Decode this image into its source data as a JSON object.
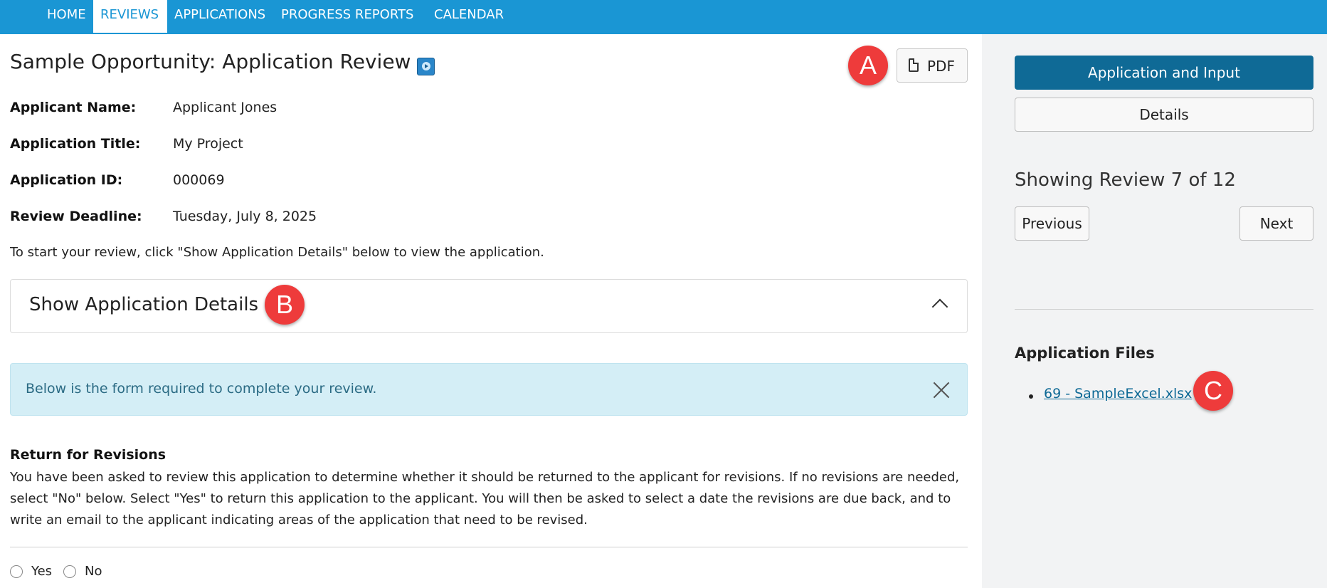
{
  "nav": {
    "items": [
      {
        "label": "HOME",
        "active": false
      },
      {
        "label": "REVIEWS",
        "active": true
      },
      {
        "label": "APPLICATIONS",
        "active": false
      },
      {
        "label": "PROGRESS REPORTS",
        "active": false
      },
      {
        "label": "CALENDAR",
        "active": false
      }
    ]
  },
  "page": {
    "title": "Sample Opportunity: Application Review",
    "pdf_label": "PDF",
    "markers": {
      "a": "A",
      "b": "B",
      "c": "C"
    }
  },
  "fields": {
    "applicant_name": {
      "label": "Applicant Name:",
      "value": "Applicant Jones"
    },
    "application_title": {
      "label": "Application Title:",
      "value": "My Project"
    },
    "application_id": {
      "label": "Application ID:",
      "value": "000069"
    },
    "review_deadline": {
      "label": "Review Deadline:",
      "value": "Tuesday, July 8, 2025"
    }
  },
  "intro": "To start your review, click \"Show Application Details\" below to view the application.",
  "accordion": {
    "title": "Show Application Details",
    "expanded": true
  },
  "alert": {
    "text": "Below is the form required to complete your review."
  },
  "revisions": {
    "title": "Return for Revisions",
    "body": "You have been asked to review this application to determine whether it should be returned to the applicant for revisions. If no revisions are needed, select \"No\" below. Select \"Yes\" to return this application to the applicant. You will then be asked to select a date the revisions are due back, and to write an email to the applicant indicating areas of the application that need to be revised.",
    "options": [
      "Yes",
      "No"
    ]
  },
  "sidebar": {
    "primary_button": "Application and Input",
    "details_button": "Details",
    "review_count": "Showing Review 7 of 12",
    "previous": "Previous",
    "next": "Next",
    "files_title": "Application Files",
    "files": [
      "69 - SampleExcel.xlsx"
    ]
  },
  "colors": {
    "nav_bg": "#1a96d4",
    "primary_button": "#0f6a96",
    "alert_bg": "#d4eef6",
    "marker": "#ee3b3b",
    "sidebar_bg": "#f2f3f4"
  }
}
